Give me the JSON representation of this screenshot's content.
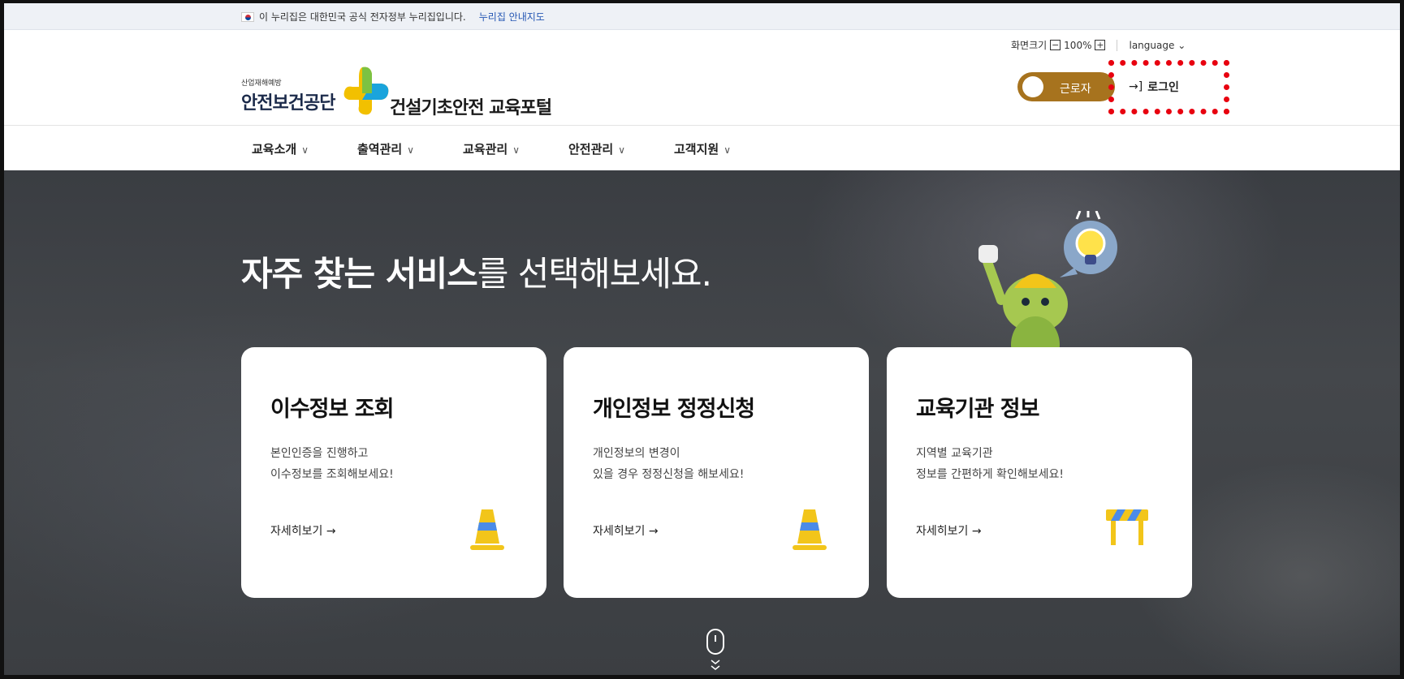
{
  "gov_bar": {
    "text": "이 누리집은 대한민국 공식 전자정부 누리집입니다.",
    "link": "누리집 안내지도"
  },
  "header": {
    "logo_small": "산업재해예방",
    "logo_main": "안전보건공단",
    "portal_title": "건설기초안전 교육포털",
    "zoom_label": "화면크기",
    "zoom_minus": "−",
    "zoom_value": "100%",
    "zoom_plus": "+",
    "language": "language",
    "toggle_label": "근로자",
    "login_label": "로그인",
    "accent_color": "#a7731e"
  },
  "nav": {
    "items": [
      {
        "label": "교육소개"
      },
      {
        "label": "출역관리"
      },
      {
        "label": "교육관리"
      },
      {
        "label": "안전관리"
      },
      {
        "label": "고객지원"
      }
    ]
  },
  "hero": {
    "title_bold": "자주 찾는 서비스",
    "title_rest": "를 선택해보세요."
  },
  "cards": [
    {
      "title": "이수정보 조회",
      "line1": "본인인증을 진행하고",
      "line2": "이수정보를 조회해보세요!",
      "more": "자세히보기 →",
      "icon": "traffic-cone-icon"
    },
    {
      "title": "개인정보 정정신청",
      "line1": "개인정보의 변경이",
      "line2": "있을 경우 정정신청을 해보세요!",
      "more": "자세히보기 →",
      "icon": "traffic-cone-icon"
    },
    {
      "title": "교육기관 정보",
      "line1": "지역별 교육기관",
      "line2": "정보를 간편하게 확인해보세요!",
      "more": "자세히보기 →",
      "icon": "barricade-icon"
    }
  ]
}
